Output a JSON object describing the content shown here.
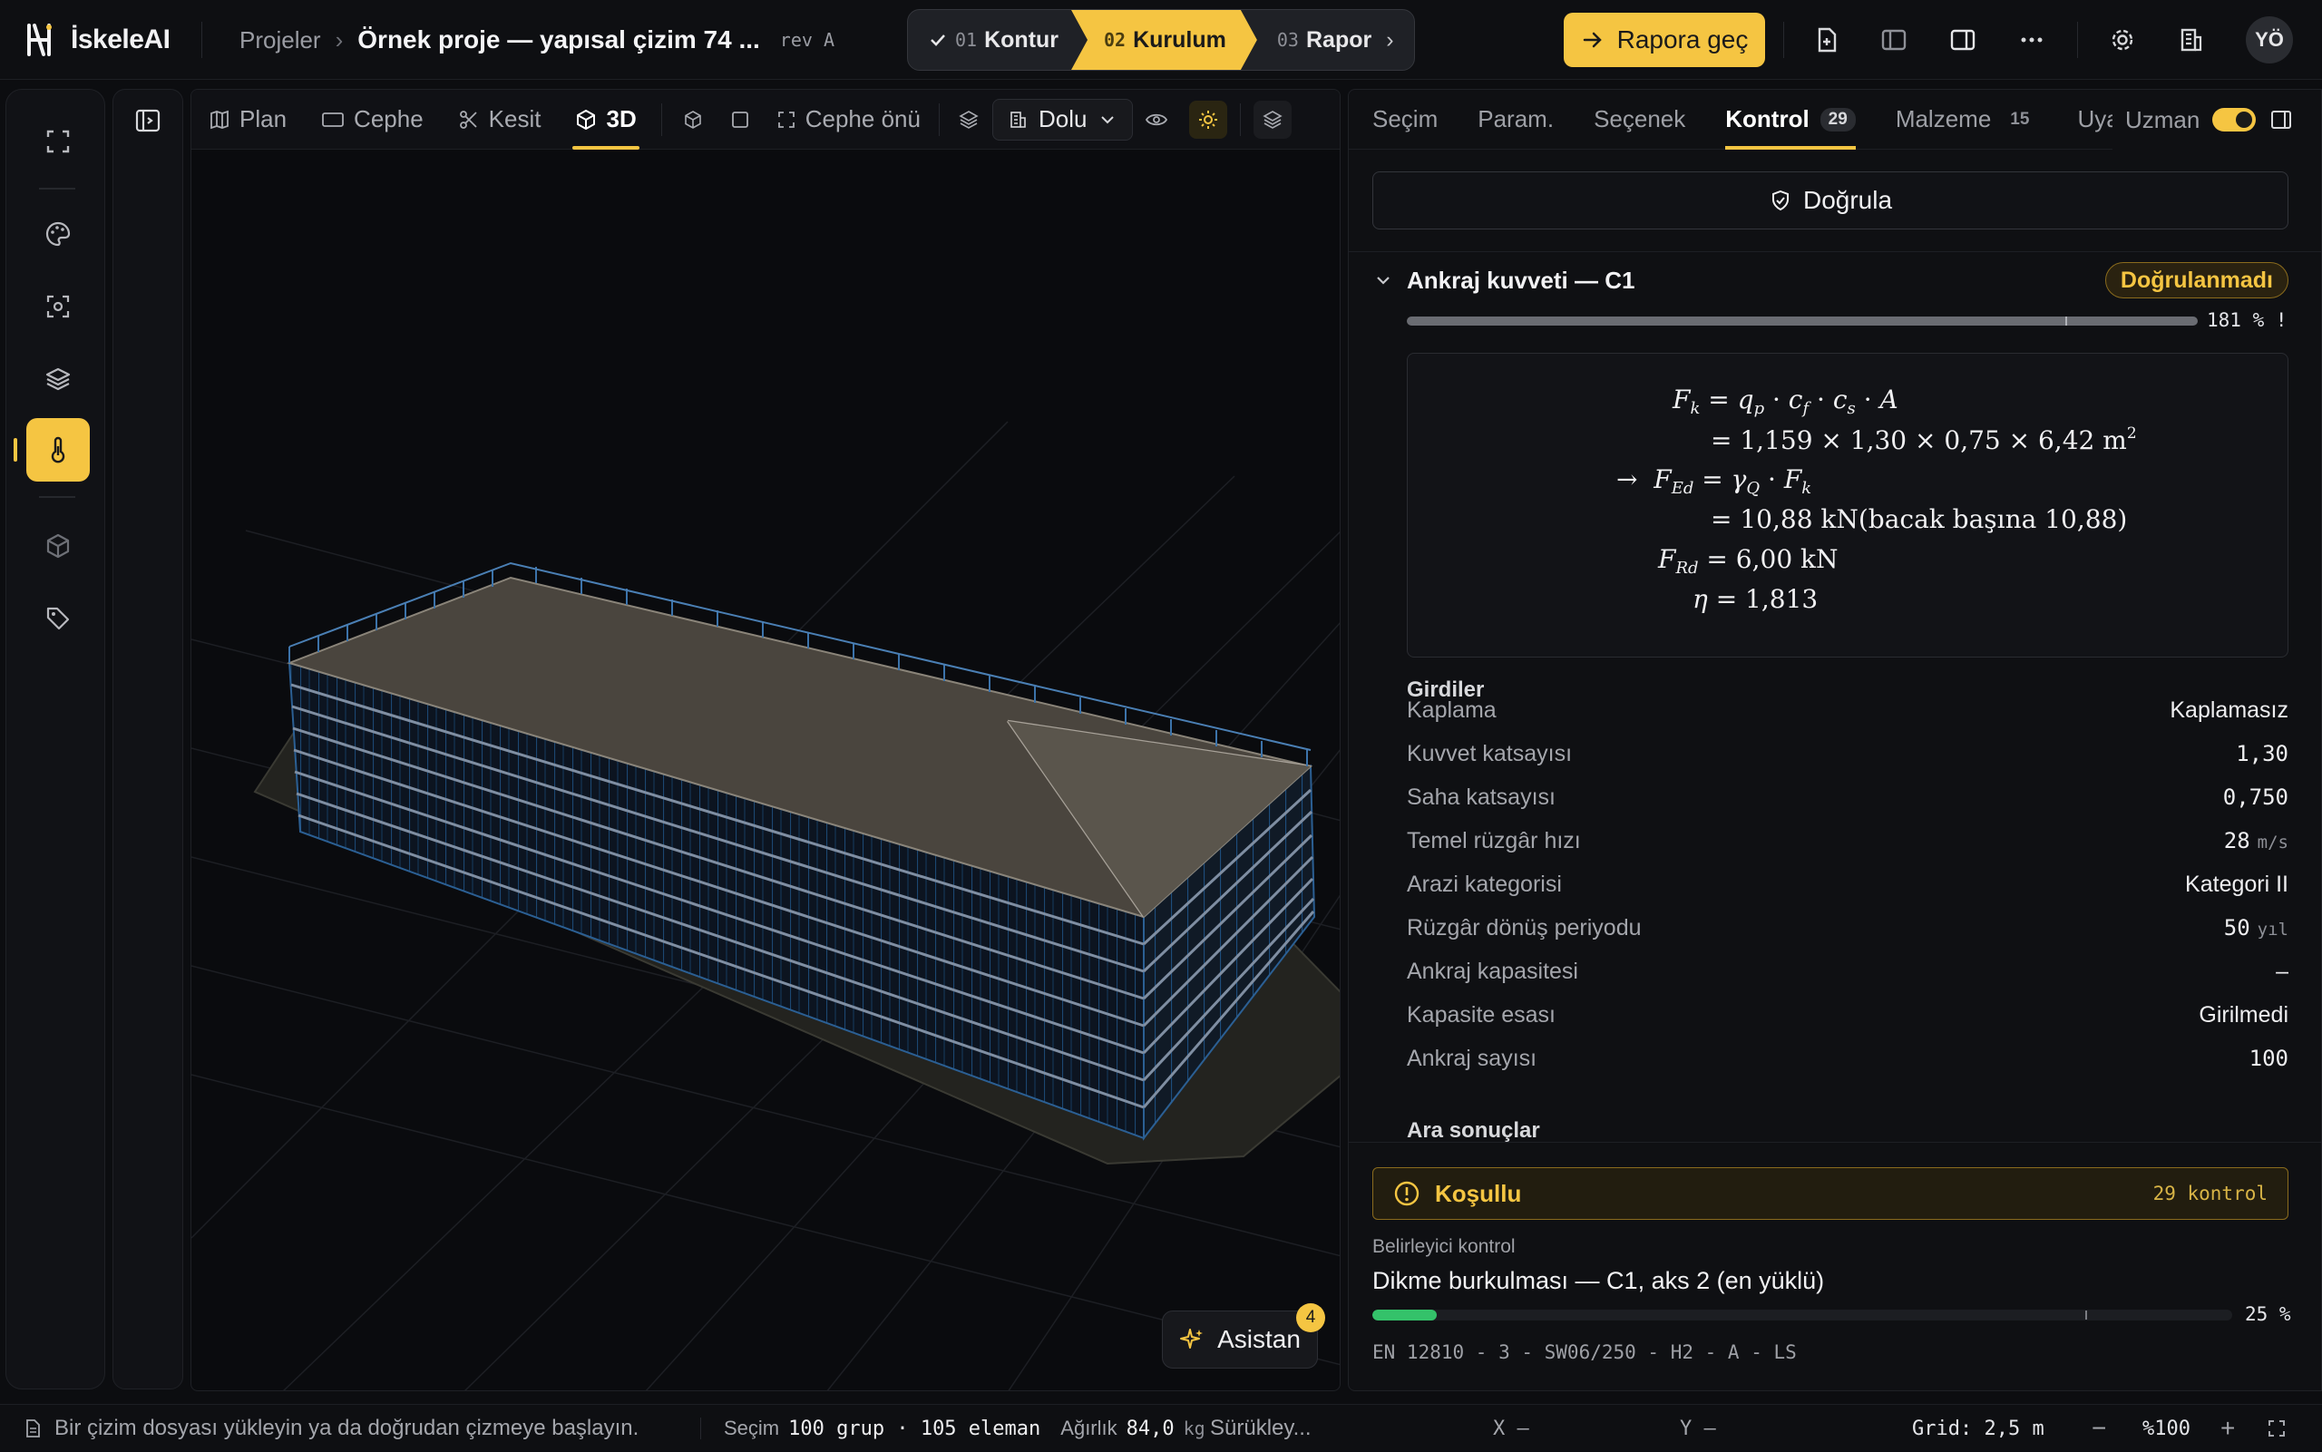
{
  "app": {
    "name": "İskeleAI"
  },
  "breadcrumb": {
    "projects": "Projeler",
    "title": "Örnek proje — yapısal çizim 74 ...",
    "rev": "rev A"
  },
  "stepper": [
    {
      "num": "01",
      "label": "Kontur",
      "state": "done"
    },
    {
      "num": "02",
      "label": "Kurulum",
      "state": "active"
    },
    {
      "num": "03",
      "label": "Rapor",
      "state": "upcoming"
    }
  ],
  "header": {
    "primary_button": "Rapora geç",
    "avatar": "YÖ"
  },
  "viewport": {
    "tabs": [
      {
        "label": "Plan",
        "icon": "map-icon"
      },
      {
        "label": "Cephe",
        "icon": "rectangle-icon"
      },
      {
        "label": "Kesit",
        "icon": "scissors-icon"
      },
      {
        "label": "3D",
        "icon": "cube-icon",
        "active": true
      }
    ],
    "facade_front": "Cephe önü",
    "render_mode": "Dolu",
    "assistant": {
      "label": "Asistan",
      "badge": "4"
    }
  },
  "right_panel": {
    "tabs": [
      {
        "label": "Seçim"
      },
      {
        "label": "Param."
      },
      {
        "label": "Seçenek"
      },
      {
        "label": "Kontrol",
        "count": "29",
        "active": true
      },
      {
        "label": "Malzeme",
        "count": "15"
      },
      {
        "label": "Uyarı"
      }
    ],
    "expert_label": "Uzman",
    "expert_enabled": true,
    "verify_button": "Doğrula",
    "check": {
      "title": "Ankraj kuvveti — C1",
      "status": "Doğrulanmadı",
      "utilization_percent": 181,
      "utilization_text": "181 % !",
      "formula": {
        "l1": "= 1,159 × 1,30 × 0,75 × 6,42",
        "l1_unit": "m",
        "l3": "= 10,88 kN(bacak başına 10,88)",
        "l4": "= 6,00 kN",
        "l5": "= 1,813"
      },
      "inputs_title": "Girdiler",
      "inputs": [
        {
          "key": "Kaplama",
          "value": "Kaplamasız",
          "unit": ""
        },
        {
          "key": "Kuvvet katsayısı",
          "value": "1,30",
          "unit": ""
        },
        {
          "key": "Saha katsayısı",
          "value": "0,750",
          "unit": ""
        },
        {
          "key": "Temel rüzgâr hızı",
          "value": "28",
          "unit": "m/s"
        },
        {
          "key": "Arazi kategorisi",
          "value": "Kategori II",
          "unit": ""
        },
        {
          "key": "Rüzgâr dönüş periyodu",
          "value": "50",
          "unit": "yıl"
        },
        {
          "key": "Ankraj kapasitesi",
          "value": "–",
          "unit": ""
        },
        {
          "key": "Kapasite esası",
          "value": "Girilmedi",
          "unit": ""
        },
        {
          "key": "Ankraj sayısı",
          "value": "100",
          "unit": ""
        }
      ],
      "intermediate_title": "Ara sonuçlar"
    },
    "summary": {
      "label": "Koşullu",
      "count": "29 kontrol"
    },
    "governing": {
      "label": "Belirleyici kontrol",
      "title": "Dikme burkulması — C1, aks 2 (en yüklü)",
      "percent": 25,
      "percent_text": "25 %",
      "code": "EN 12810 - 3 - SW06/250 - H2 - A - LS"
    }
  },
  "status_bar": {
    "hint": "Bir çizim dosyası yükleyin ya da doğrudan çizmeye başlayın.",
    "selection_label": "Seçim",
    "selection_value": "100 grup · 105 eleman",
    "weight_label": "Ağırlık",
    "weight_value": "84,0",
    "weight_unit": "kg",
    "drag": "Sürükley...",
    "x": "X –",
    "y": "Y –",
    "grid": "Grid: 2,5 m",
    "zoom": "%100"
  },
  "colors": {
    "accent": "#f5c542",
    "ok": "#34c26a",
    "warn_border": "#8a6b1d"
  }
}
